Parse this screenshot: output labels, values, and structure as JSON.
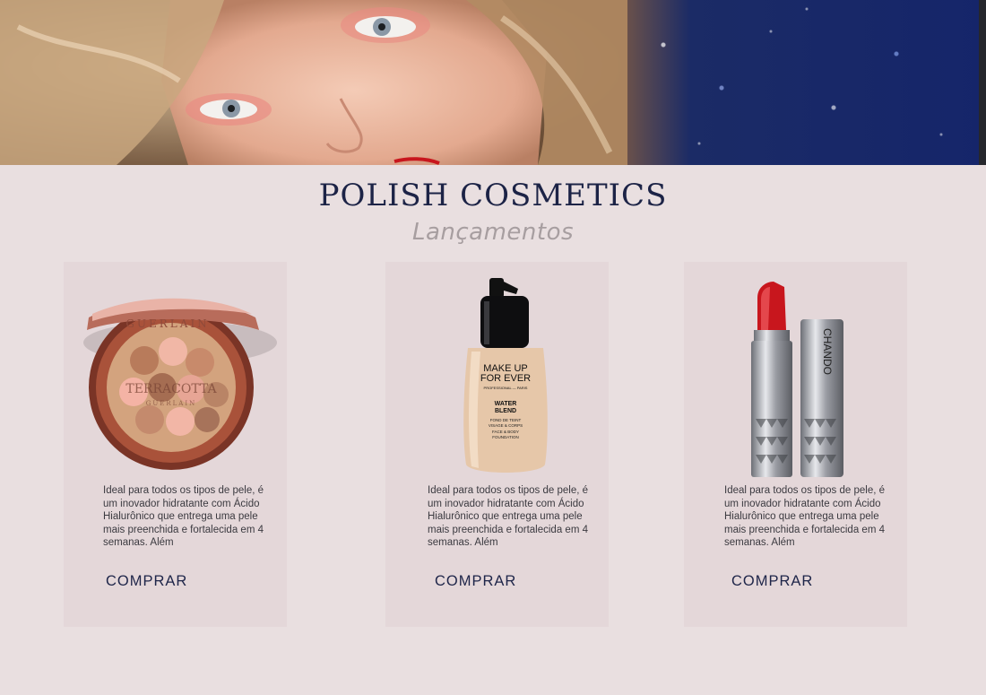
{
  "header": {
    "brand": "POLISH COSMETICS",
    "subtitle": "Lançamentos"
  },
  "products": [
    {
      "name": "Guerlain Terracotta",
      "image_text_1": "GUERLAIN",
      "image_text_2": "TERRACOTTA",
      "image_text_3": "GUERLAIN",
      "description": "Ideal para todos os tipos de pele, é um inovador hidratante com Ácido Hialurônico que entrega uma pele mais preenchida e fortalecida em 4 semanas. Além",
      "buy_label": "COMPRAR"
    },
    {
      "name": "Make Up For Ever Water Blend",
      "image_text_1": "MAKE UP",
      "image_text_2": "FOR EVER",
      "image_text_3": "PROFESSIONAL — PARIS",
      "image_text_4": "WATER",
      "image_text_5": "BLEND",
      "image_text_6": "FOND DE TEINT",
      "image_text_7": "VISAGE & CORPS",
      "image_text_8": "FACE & BODY",
      "image_text_9": "FOUNDATION",
      "description": "Ideal para todos os tipos de pele, é um inovador hidratante com Ácido Hialurônico que entrega uma pele mais preenchida e fortalecida em 4 semanas. Além",
      "buy_label": "COMPRAR"
    },
    {
      "name": "Chando Lipstick",
      "image_text_1": "CHANDO",
      "description": "Ideal para todos os tipos de pele, é um inovador hidratante com Ácido Hialurônico que entrega uma pele mais preenchida e fortalecida em 4 semanas. Além",
      "buy_label": "COMPRAR"
    }
  ],
  "colors": {
    "background": "#e9dfe0",
    "card": "#e4d7d9",
    "brand_text": "#1c2346",
    "subtitle_text": "#a79ea0",
    "accent_red": "#c8161d"
  }
}
